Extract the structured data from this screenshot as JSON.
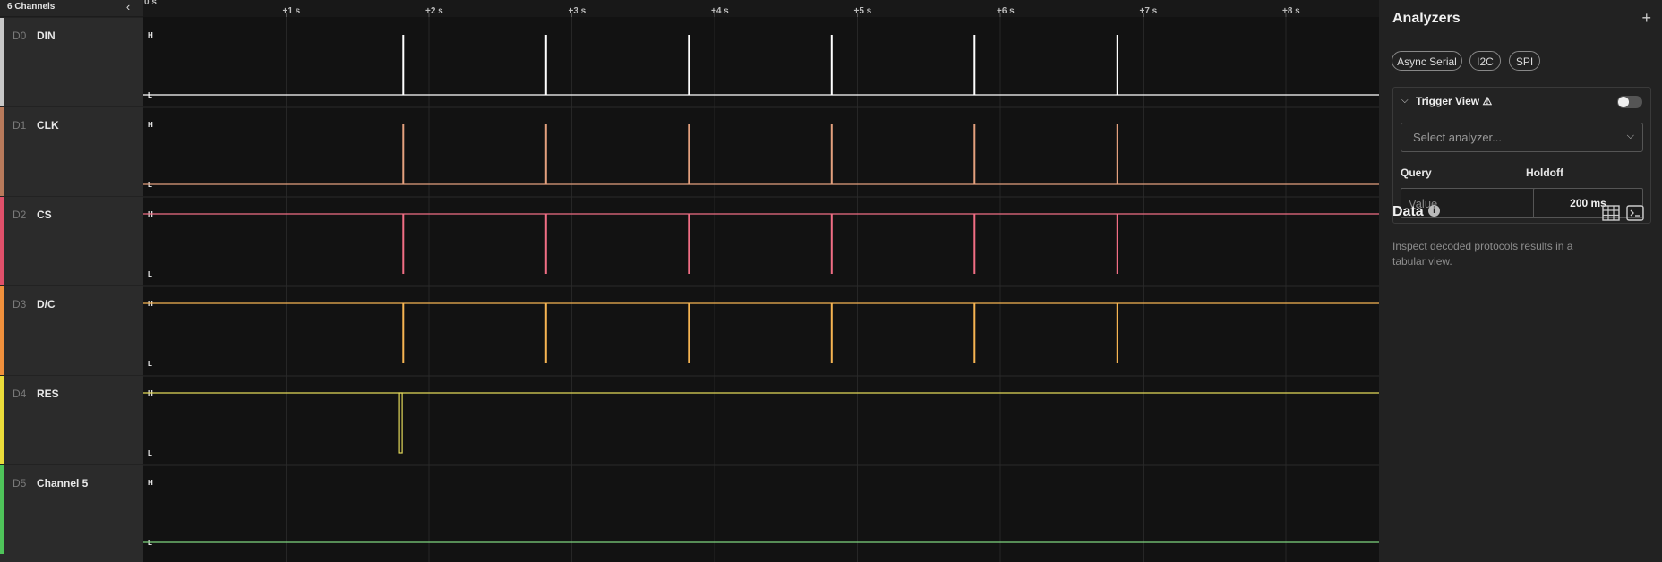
{
  "channels_header": {
    "title": "6 Channels",
    "collapse_icon": "chevron-left-icon"
  },
  "channels": [
    {
      "index": "D0",
      "name": "DIN",
      "color": "#c8c8c8",
      "wave": "#ffffff",
      "idle": "low"
    },
    {
      "index": "D1",
      "name": "CLK",
      "color": "#b87a5b",
      "wave": "#e3a07e",
      "idle": "low"
    },
    {
      "index": "D2",
      "name": "CS",
      "color": "#e0506a",
      "wave": "#f06e84",
      "idle": "high"
    },
    {
      "index": "D3",
      "name": "D/C",
      "color": "#f0903c",
      "wave": "#f6b452",
      "idle": "high"
    },
    {
      "index": "D4",
      "name": "RES",
      "color": "#eadc3a",
      "wave": "#e2d85a",
      "idle": "high"
    },
    {
      "index": "D5",
      "name": "Channel 5",
      "color": "#4fc45a",
      "wave": "#7fd67f",
      "idle": "low"
    }
  ],
  "timeline": {
    "origin_label": "0 s",
    "ticks": [
      "+1 s",
      "+2 s",
      "+3 s",
      "+4 s",
      "+5 s",
      "+6 s",
      "+7 s",
      "+8 s"
    ],
    "level_high": "H",
    "level_low": "L",
    "pulse_times_s": [
      1.82,
      2.82,
      3.82,
      4.82,
      5.82,
      6.82
    ],
    "res_pulse_time_s": 1.8
  },
  "analyzers": {
    "title": "Analyzers",
    "add_icon": "plus-icon",
    "chips": [
      "Async Serial",
      "I2C",
      "SPI"
    ],
    "trigger": {
      "title": "Trigger View",
      "warning_icon": "warning-icon",
      "toggle_on": false,
      "select_placeholder": "Select analyzer...",
      "query_label": "Query",
      "query_placeholder": "Value",
      "holdoff_label": "Holdoff",
      "holdoff_value": "200 ms"
    }
  },
  "data_panel": {
    "title": "Data",
    "description": "Inspect decoded protocols results in a tabular view."
  }
}
